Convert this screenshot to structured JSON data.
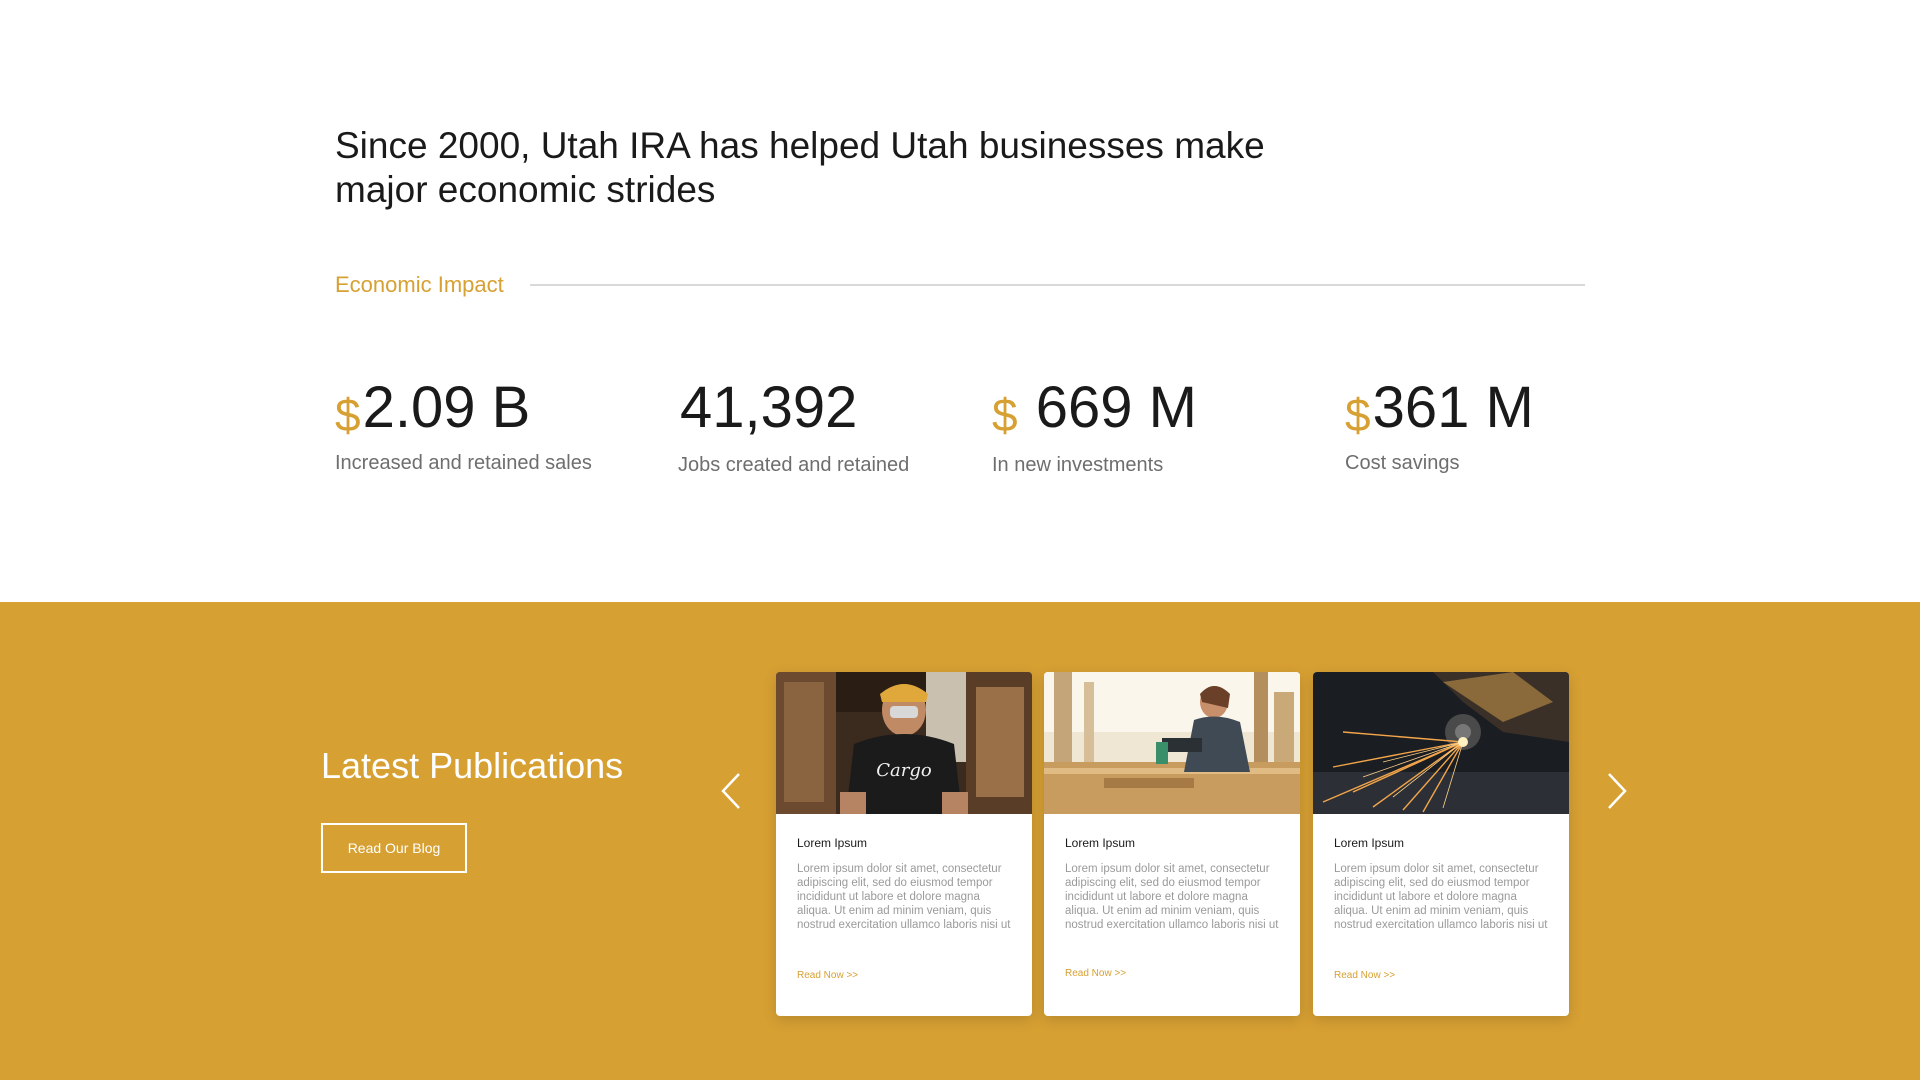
{
  "hero": {
    "title": "Since 2000, Utah IRA has helped Utah businesses make major economic strides"
  },
  "impact": {
    "label": "Economic Impact",
    "stats": [
      {
        "currency": "$",
        "value": "2.09 B",
        "caption": "Increased and retained sales"
      },
      {
        "currency": "",
        "value": "41,392",
        "caption": "Jobs created and retained"
      },
      {
        "currency": "$",
        "value": " 669 M",
        "caption": "In new investments"
      },
      {
        "currency": "$",
        "value": "361 M",
        "caption": "Cost savings"
      }
    ]
  },
  "publications": {
    "title": "Latest Publications",
    "blog_button": "Read Our Blog",
    "prev_icon": "chevron-left-icon",
    "next_icon": "chevron-right-icon",
    "cards": [
      {
        "image": "worker-cargo-shirt-photo",
        "title": "Lorem Ipsum",
        "text": "Lorem ipsum dolor sit amet, consectetur adipiscing elit, sed do eiusmod tempor incididunt ut labore et dolore magna aliqua. Ut enim ad minim veniam, quis nostrud exercitation ullamco laboris nisi ut",
        "link": "Read Now >>"
      },
      {
        "image": "woodworker-drill-photo",
        "title": "Lorem Ipsum",
        "text": "Lorem ipsum dolor sit amet, consectetur adipiscing elit, sed do eiusmod tempor incididunt ut labore et dolore magna aliqua. Ut enim ad minim veniam, quis nostrud exercitation ullamco laboris nisi ut",
        "link": "Read Now >>"
      },
      {
        "image": "metal-grinder-sparks-photo",
        "title": "Lorem Ipsum",
        "text": "Lorem ipsum dolor sit amet, consectetur adipiscing elit, sed do eiusmod tempor incididunt ut labore et dolore magna aliqua. Ut enim ad minim veniam, quis nostrud exercitation ullamco laboris nisi ut",
        "link": "Read Now >>"
      }
    ]
  },
  "colors": {
    "accent": "#d7a033",
    "text": "#1a1a1a",
    "muted": "#6e6e6e"
  }
}
